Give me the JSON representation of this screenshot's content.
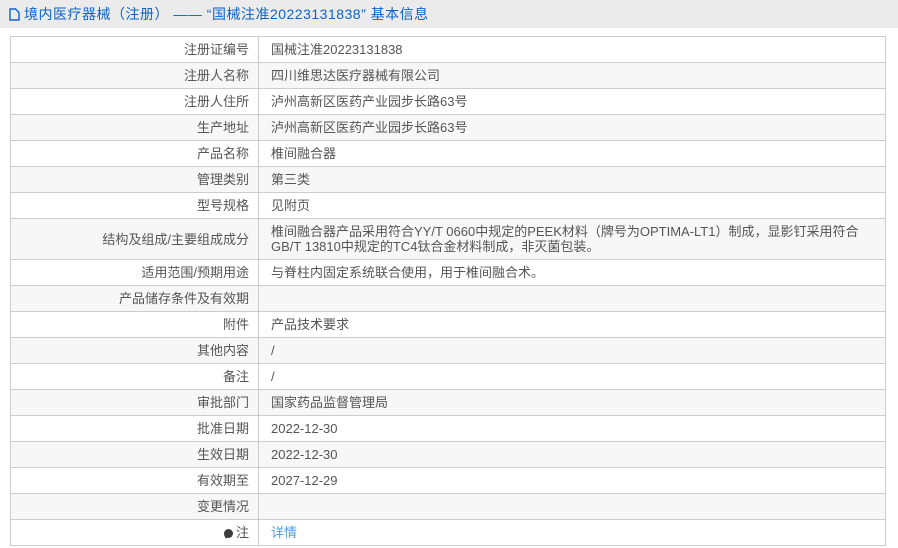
{
  "colors": {
    "title_blue": "#0c63cc",
    "link_blue": "#4d9ee8",
    "header_bg": "#ebebeb",
    "row_alt_bg": "#f7f7f7",
    "border": "#cccccc",
    "text": "#555555"
  },
  "header": {
    "icon": "document-icon",
    "title": "境内医疗器械（注册） —— “国械注准20223131838” 基本信息"
  },
  "table": {
    "rows": [
      {
        "label": "注册证编号",
        "value": "国械注准20223131838"
      },
      {
        "label": "注册人名称",
        "value": "四川维思达医疗器械有限公司"
      },
      {
        "label": "注册人住所",
        "value": "泸州高新区医药产业园步长路63号"
      },
      {
        "label": "生产地址",
        "value": "泸州高新区医药产业园步长路63号"
      },
      {
        "label": "产品名称",
        "value": "椎间融合器"
      },
      {
        "label": "管理类别",
        "value": "第三类"
      },
      {
        "label": "型号规格",
        "value": "见附页"
      },
      {
        "label": "结构及组成/主要组成成分",
        "value": "椎间融合器产品采用符合YY/T 0660中规定的PEEK材料（牌号为OPTIMA-LT1）制成，显影钉采用符合GB/T 13810中规定的TC4钛合金材料制成，非灭菌包装。"
      },
      {
        "label": "适用范围/预期用途",
        "value": "与脊柱内固定系统联合使用，用于椎间融合术。"
      },
      {
        "label": "产品储存条件及有效期",
        "value": ""
      },
      {
        "label": "附件",
        "value": "产品技术要求"
      },
      {
        "label": "其他内容",
        "value": "/"
      },
      {
        "label": "备注",
        "value": "/"
      },
      {
        "label": "审批部门",
        "value": "国家药品监督管理局"
      },
      {
        "label": "批准日期",
        "value": "2022-12-30"
      },
      {
        "label": "生效日期",
        "value": "2022-12-30"
      },
      {
        "label": "有效期至",
        "value": "2027-12-29"
      },
      {
        "label": "变更情况",
        "value": ""
      },
      {
        "label": "注",
        "icon": "note-balloon-icon",
        "link_label": "详情"
      }
    ]
  }
}
